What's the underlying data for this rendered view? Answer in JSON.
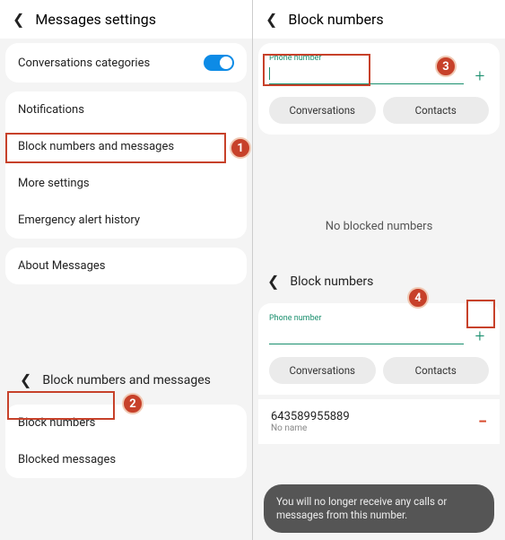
{
  "left": {
    "header": "Messages settings",
    "row_conv_cat": "Conversations categories",
    "row_notifications": "Notifications",
    "row_block": "Block numbers and messages",
    "row_more": "More settings",
    "row_emergency": "Emergency alert history",
    "row_about": "About Messages",
    "subheader": "Block numbers and messages",
    "row_block_numbers": "Block numbers",
    "row_blocked_msgs": "Blocked messages"
  },
  "right": {
    "header_top": "Block numbers",
    "phone_label": "Phone number",
    "chip_conversations": "Conversations",
    "chip_contacts": "Contacts",
    "empty": "No blocked numbers",
    "header_mid": "Block numbers",
    "phone_label2": "Phone number",
    "blocked_number": "643589955889",
    "blocked_noname": "No name",
    "toast": "You will no longer receive any calls or messages from this number."
  },
  "badges": {
    "1": "1",
    "2": "2",
    "3": "3",
    "4": "4"
  }
}
